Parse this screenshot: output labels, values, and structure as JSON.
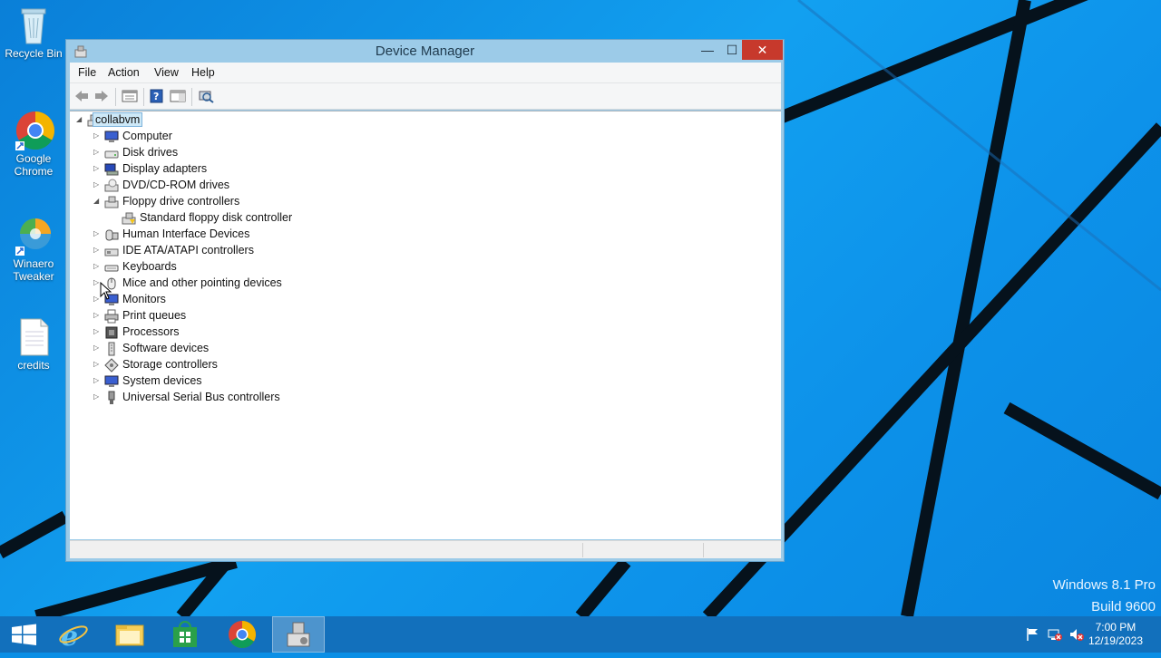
{
  "desktop": {
    "icons": [
      {
        "label": "Recycle Bin"
      },
      {
        "label": "Google Chrome"
      },
      {
        "label": "Winaero Tweaker"
      },
      {
        "label": "credits"
      }
    ],
    "watermark": {
      "line1": "Windows 8.1 Pro",
      "line2": "Build 9600"
    }
  },
  "window": {
    "title": "Device Manager",
    "controls": {
      "minimize": "—",
      "maximize": "☐",
      "close": "✕"
    },
    "menu": [
      "File",
      "Action",
      "View",
      "Help"
    ],
    "toolbar": [
      "back-icon",
      "forward-icon",
      "properties-pane-icon",
      "help-icon",
      "show-hide-icon",
      "scan-hardware-icon"
    ],
    "tree": {
      "root": "collabvm",
      "categories": [
        {
          "label": "Computer",
          "expanded": false
        },
        {
          "label": "Disk drives",
          "expanded": false
        },
        {
          "label": "Display adapters",
          "expanded": false
        },
        {
          "label": "DVD/CD-ROM drives",
          "expanded": false
        },
        {
          "label": "Floppy drive controllers",
          "expanded": true,
          "children": [
            "Standard floppy disk controller"
          ]
        },
        {
          "label": "Human Interface Devices",
          "expanded": false
        },
        {
          "label": "IDE ATA/ATAPI controllers",
          "expanded": false
        },
        {
          "label": "Keyboards",
          "expanded": false
        },
        {
          "label": "Mice and other pointing devices",
          "expanded": false
        },
        {
          "label": "Monitors",
          "expanded": false
        },
        {
          "label": "Print queues",
          "expanded": false
        },
        {
          "label": "Processors",
          "expanded": false
        },
        {
          "label": "Software devices",
          "expanded": false
        },
        {
          "label": "Storage controllers",
          "expanded": false
        },
        {
          "label": "System devices",
          "expanded": false
        },
        {
          "label": "Universal Serial Bus controllers",
          "expanded": false
        }
      ]
    }
  },
  "taskbar": {
    "items": [
      "start-icon",
      "internet-explorer-icon",
      "file-explorer-icon",
      "store-icon",
      "chrome-icon",
      "device-manager-icon"
    ],
    "clock": {
      "time": "7:00 PM",
      "date": "12/19/2023"
    }
  },
  "colors": {
    "accent": "#0a8fe6",
    "close": "#c7392c",
    "selection": "#cde8f7"
  }
}
